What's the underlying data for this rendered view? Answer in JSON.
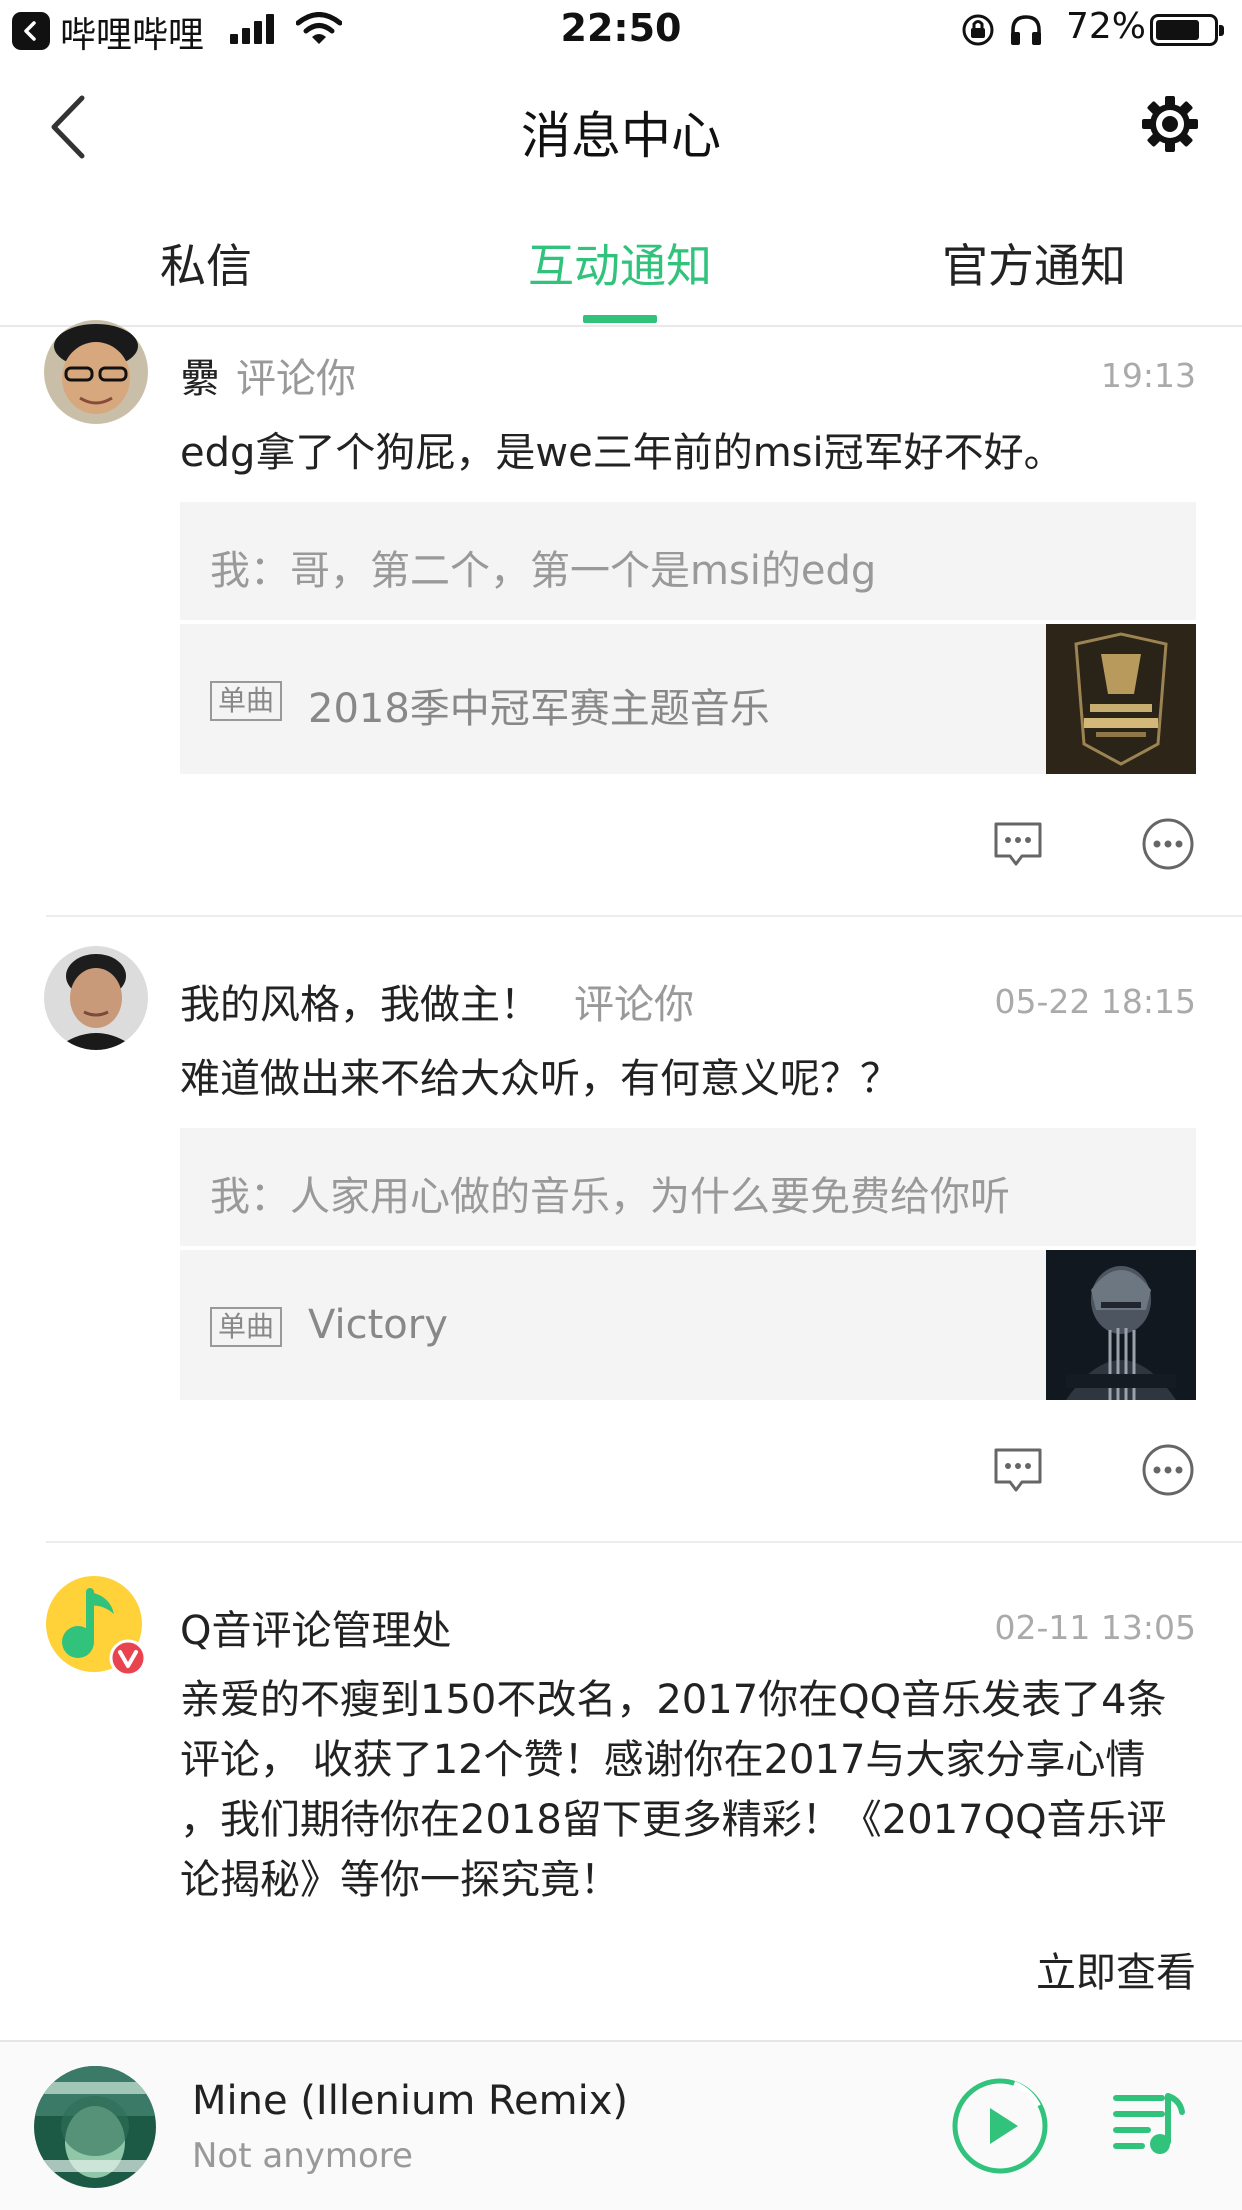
{
  "status_bar": {
    "back_app": "哔哩哔哩",
    "time": "22:50",
    "battery": "72%"
  },
  "nav": {
    "title": "消息中心",
    "back_icon": "chevron-left-icon",
    "settings_icon": "gear-icon"
  },
  "tabs": [
    {
      "label": "私信",
      "active": false
    },
    {
      "label": "互动通知",
      "active": true
    },
    {
      "label": "官方通知",
      "active": false
    }
  ],
  "accent_color": "#31c27c",
  "notifications": [
    {
      "user": "纍",
      "action": "评论你",
      "time": "19:13",
      "comment": "edg拿了个狗屁，是we三年前的msi冠军好不好。",
      "my_comment": "我：哥，第二个，第一个是msi的edg",
      "song_tag": "单曲",
      "song_title": "2018季中冠军赛主题音乐"
    },
    {
      "user": "我的风格，我做主！",
      "action": "评论你",
      "time": "05-22 18:15",
      "comment": "难道做出来不给大众听，有何意义呢？？",
      "my_comment": "我：人家用心做的音乐，为什么要免费给你听",
      "song_tag": "单曲",
      "song_title": "Victory"
    }
  ],
  "system_notice": {
    "sender": "Q音评论管理处",
    "time": "02-11 13:05",
    "lines": [
      "亲爱的不瘦到150不改名，2017你在QQ音乐发表了4条",
      "评论， 收获了12个赞！感谢你在2017与大家分享心情",
      "，我们期待你在2018留下更多精彩！《2017QQ音乐评",
      "论揭秘》等你一探究竟！"
    ],
    "link": "立即查看"
  },
  "player": {
    "title": "Mine (Illenium Remix)",
    "subtitle": "Not anymore"
  }
}
